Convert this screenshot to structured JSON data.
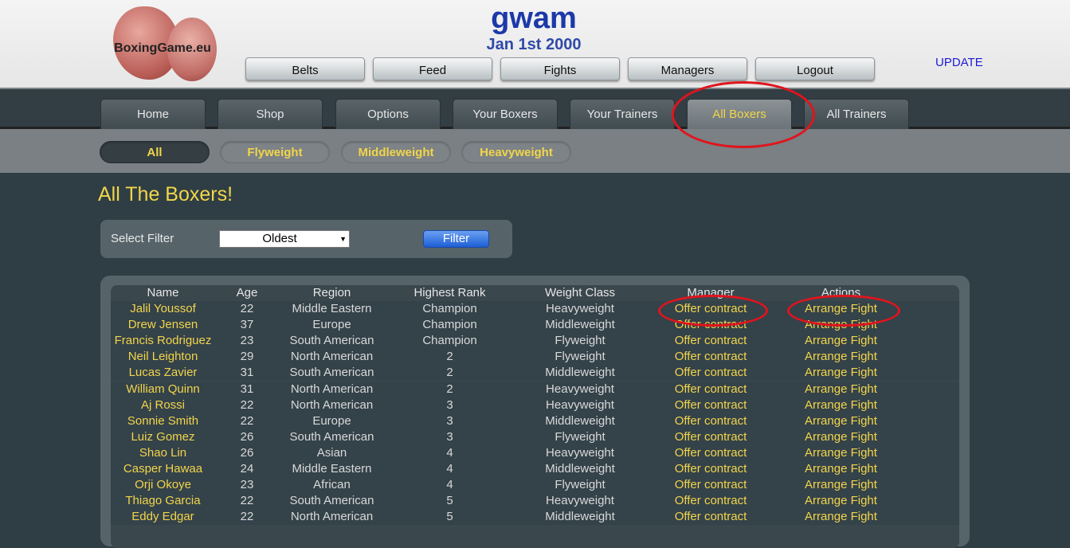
{
  "header": {
    "logo_text": "BoxingGame.eu",
    "title": "gwam",
    "date": "Jan 1st 2000",
    "update": "UPDATE",
    "top_buttons": [
      "Belts",
      "Feed",
      "Fights",
      "Managers",
      "Logout"
    ]
  },
  "mainnav": {
    "tabs": [
      "Home",
      "Shop",
      "Options",
      "Your Boxers",
      "Your Trainers",
      "All Boxers",
      "All Trainers"
    ],
    "active": "All Boxers"
  },
  "subnav": {
    "pills": [
      "All",
      "Flyweight",
      "Middleweight",
      "Heavyweight"
    ],
    "active": "All"
  },
  "page": {
    "heading": "All The Boxers!",
    "filter_label": "Select Filter",
    "filter_value": "Oldest",
    "filter_button": "Filter"
  },
  "table": {
    "columns": [
      "Name",
      "Age",
      "Region",
      "Highest Rank",
      "Weight Class",
      "Manager",
      "Actions"
    ],
    "rows": [
      [
        "Jalil Youssof",
        "22",
        "Middle Eastern",
        "Champion",
        "Heavyweight",
        "Offer contract",
        "Arrange Fight"
      ],
      [
        "Drew Jensen",
        "37",
        "Europe",
        "Champion",
        "Middleweight",
        "Offer contract",
        "Arrange Fight"
      ],
      [
        "Francis Rodriguez",
        "23",
        "South American",
        "Champion",
        "Flyweight",
        "Offer contract",
        "Arrange Fight"
      ],
      [
        "Neil Leighton",
        "29",
        "North American",
        "2",
        "Flyweight",
        "Offer contract",
        "Arrange Fight"
      ],
      [
        "Lucas Zavier",
        "31",
        "South American",
        "2",
        "Middleweight",
        "Offer contract",
        "Arrange Fight"
      ],
      [
        "William Quinn",
        "31",
        "North American",
        "2",
        "Heavyweight",
        "Offer contract",
        "Arrange Fight"
      ],
      [
        "Aj Rossi",
        "22",
        "North American",
        "3",
        "Heavyweight",
        "Offer contract",
        "Arrange Fight"
      ],
      [
        "Sonnie Smith",
        "22",
        "Europe",
        "3",
        "Middleweight",
        "Offer contract",
        "Arrange Fight"
      ],
      [
        "Luiz Gomez",
        "26",
        "South American",
        "3",
        "Flyweight",
        "Offer contract",
        "Arrange Fight"
      ],
      [
        "Shao Lin",
        "26",
        "Asian",
        "4",
        "Heavyweight",
        "Offer contract",
        "Arrange Fight"
      ],
      [
        "Casper Hawaa",
        "24",
        "Middle Eastern",
        "4",
        "Middleweight",
        "Offer contract",
        "Arrange Fight"
      ],
      [
        "Orji Okoye",
        "23",
        "African",
        "4",
        "Flyweight",
        "Offer contract",
        "Arrange Fight"
      ],
      [
        "Thiago Garcia",
        "22",
        "South American",
        "5",
        "Heavyweight",
        "Offer contract",
        "Arrange Fight"
      ],
      [
        "Eddy Edgar",
        "22",
        "North American",
        "5",
        "Middleweight",
        "Offer contract",
        "Arrange Fight"
      ]
    ]
  },
  "colors": {
    "accent_yellow": "#f1d54a",
    "title_blue": "#1b39a8",
    "annotation_red": "#e0141d"
  }
}
